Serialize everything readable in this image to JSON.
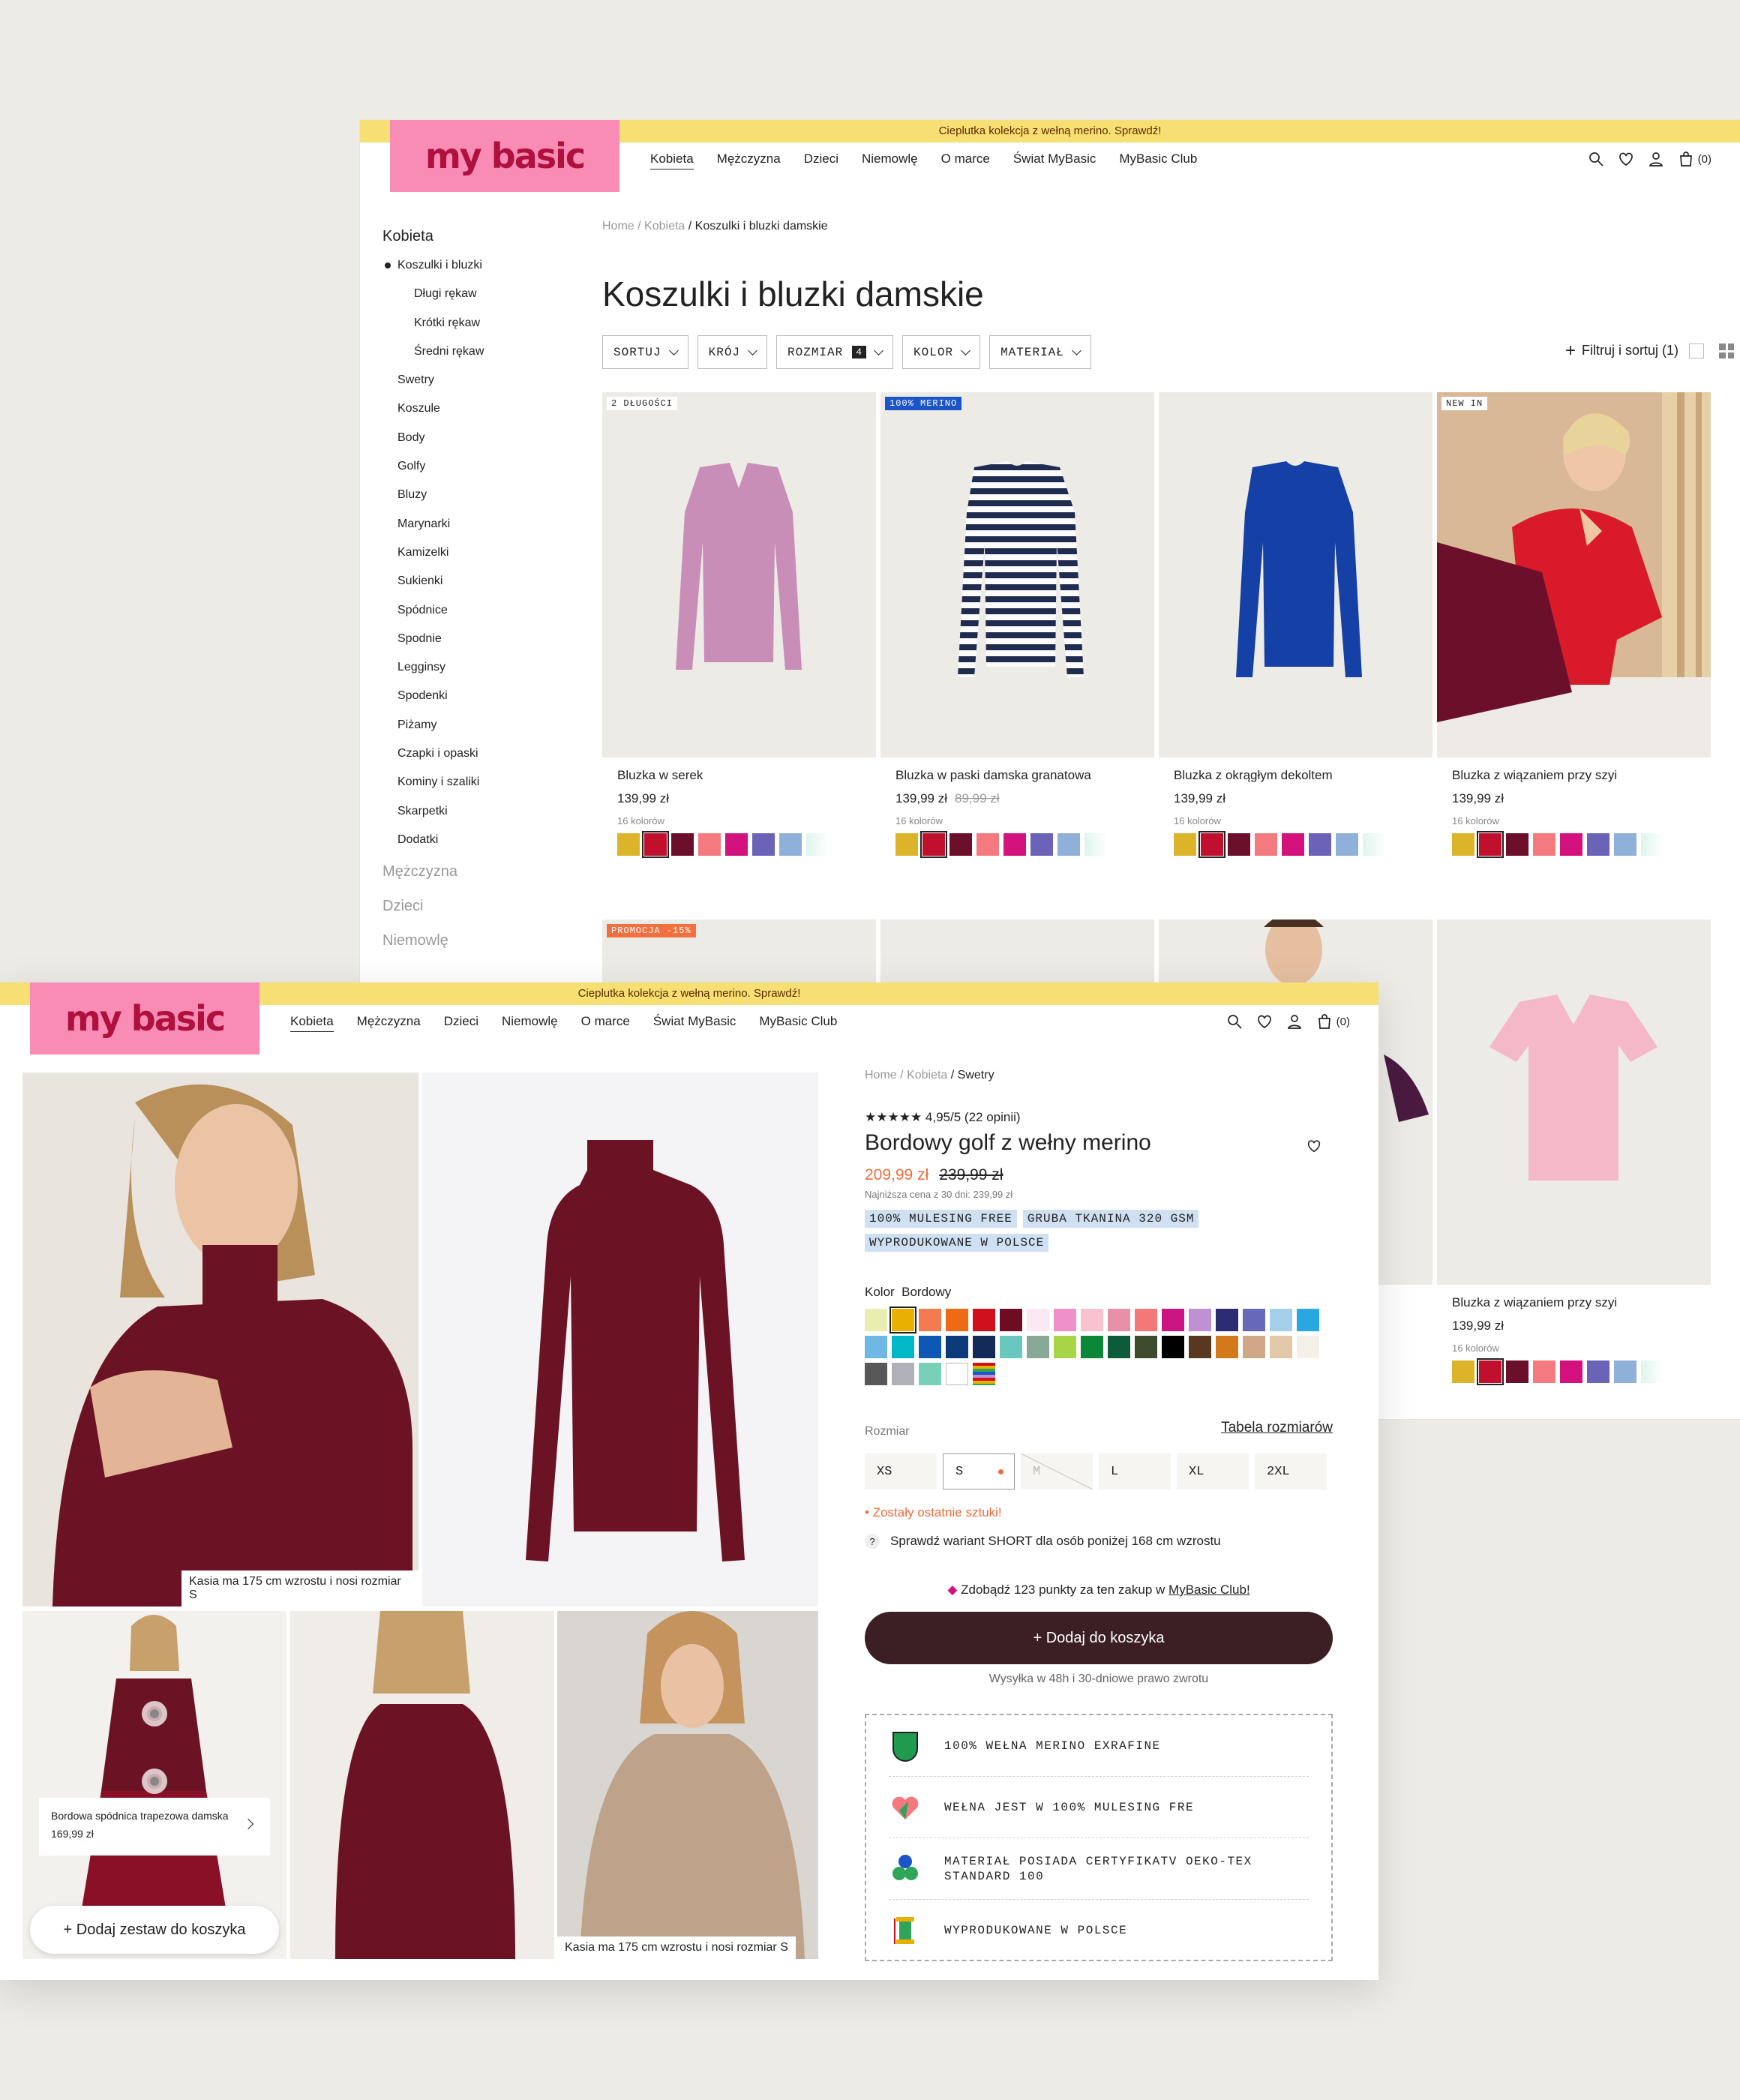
{
  "common": {
    "promo": "Cieplutka kolekcja z wełną merino. Sprawdź!",
    "logo": "my basic",
    "nav": [
      "Kobieta",
      "Mężczyzna",
      "Dzieci",
      "Niemowlę",
      "O marce",
      "Świat MyBasic",
      "MyBasic Club"
    ],
    "cart_count": "(0)"
  },
  "listing": {
    "breadcrumb": {
      "home": "Home",
      "sep": "/",
      "level1": "Kobieta",
      "current": "Koszulki i bluzki damskie"
    },
    "sidebar": {
      "top": "Kobieta",
      "current": "Koszulki i bluzki",
      "sub": [
        "Długi rękaw",
        "Krótki rękaw",
        "Średni rękaw"
      ],
      "items": [
        "Swetry",
        "Koszule",
        "Body",
        "Golfy",
        "Bluzy",
        "Marynarki",
        "Kamizelki",
        "Sukienki",
        "Spódnice",
        "Spodnie",
        "Legginsy",
        "Spodenki",
        "Piżamy",
        "Czapki i opaski",
        "Kominy i szaliki",
        "Skarpetki",
        "Dodatki"
      ],
      "muted": [
        "Mężczyzna",
        "Dzieci",
        "Niemowlę"
      ]
    },
    "title": "Koszulki i bluzki damskie",
    "filters": {
      "sort": "SORTUJ",
      "cut": "KRÓJ",
      "size": "ROZMIAR",
      "size_count": "4",
      "color": "KOLOR",
      "material": "MATERIAŁ",
      "filter_sort": "Filtruj i sortuj (1)"
    },
    "products": [
      {
        "badge": "2 DŁUGOŚCI",
        "name": "Bluzka w serek",
        "price": "139,99 zł",
        "old_price": "",
        "colors": "16 kolorów",
        "garment_color": "#c98eb8"
      },
      {
        "badge": "100% MERINO",
        "name": "Bluzka w paski damska granatowa",
        "price": "139,99 zł",
        "old_price": "89,99 zł",
        "colors": "16 kolorów",
        "garment_color": "#1f2b4f"
      },
      {
        "badge": "",
        "name": "Bluzka z okrągłym dekoltem",
        "price": "139,99 zł",
        "old_price": "",
        "colors": "16 kolorów",
        "garment_color": "#1540a6"
      },
      {
        "badge": "NEW IN",
        "name": "Bluzka z wiązaniem przy szyi",
        "price": "139,99 zł",
        "old_price": "",
        "colors": "16 kolorów",
        "garment_color": "#d91a2a"
      }
    ],
    "row2": {
      "badge": "PROMOCJA -15%",
      "name": "Bluzka z wiązaniem przy szyi",
      "price": "139,99 zł",
      "colors": "16 kolorów"
    },
    "swatches": [
      "#dcb42a",
      "#c0102e",
      "#6b0f2b",
      "#f47a80",
      "#d4127e",
      "#6a63b8",
      "#8fb0d8",
      "#def4ec"
    ]
  },
  "product": {
    "breadcrumb": {
      "home": "Home",
      "sep": "/",
      "level1": "Kobieta",
      "current": "Swetry"
    },
    "rating": "★★★★★ 4,95/5 (22 opinii)",
    "name": "Bordowy golf z wełny merino",
    "price": "209,99 zł",
    "old_price": "239,99 zł",
    "lowest": "Najniższa cena z 30 dni: 239,99 zł",
    "tags": [
      "100% MULESING FREE",
      "GRUBA TKANINA 320 GSM",
      "WYPRODUKOWANE W POLSCE"
    ],
    "color_label": "Kolor",
    "color_value": "Bordowy",
    "colors": [
      "#e9edb0",
      "#e8b000",
      "#f47a52",
      "#ee6a14",
      "#d0101c",
      "#6e0c24",
      "#fbe8f2",
      "#f090c8",
      "#f9c2cf",
      "#e890a8",
      "#f47878",
      "#cc1480",
      "#c090d4",
      "#2c2c72",
      "#6868b8",
      "#a4d0ec",
      "#28a8e0",
      "#70b8e4",
      "#00b8c8",
      "#0c58b4",
      "#0a3a7a",
      "#142a58",
      "#68c8c0",
      "#88a898",
      "#a8d448",
      "#0a8838",
      "#0c5c38",
      "#3c4c2c",
      "#000000",
      "#5a3820",
      "#d4781c",
      "#d0a888",
      "#e0c8a8",
      "#f4f0e8",
      "#585858",
      "#b0b0b8",
      "#78d0b8",
      "#ffffff",
      "multi"
    ],
    "size_label": "Rozmiar",
    "size_table": "Tabela rozmiarów",
    "sizes": [
      "XS",
      "S",
      "M",
      "L",
      "XL",
      "2XL"
    ],
    "stock": "Zostały ostatnie sztuki!",
    "short_variant": "Sprawdź wariant SHORT dla osób poniżej 168 cm wzrostu",
    "club_text": "Zdobądź 123 punkty za ten zakup w",
    "club_link": "MyBasic Club!",
    "add_to_cart": "Dodaj do koszyka",
    "shipping": "Wysyłka w 48h i 30-dniowe prawo zwrotu",
    "features": [
      "100% WEŁNA MERINO EXRAFINE",
      "WEŁNA JEST W 100% MULESING FRE",
      "MATERIAŁ POSIADA CERTYFIKATV OEKO-TEX STANDARD 100",
      "WYPRODUKOWANE W POLSCE"
    ],
    "caption": "Kasia ma 175 cm wzrostu i nosi rozmiar S",
    "skirt_name": "Bordowa spódnica trapezowa damska",
    "skirt_price": "169,99 zł",
    "set_button": "Dodaj zestaw do koszyka"
  }
}
